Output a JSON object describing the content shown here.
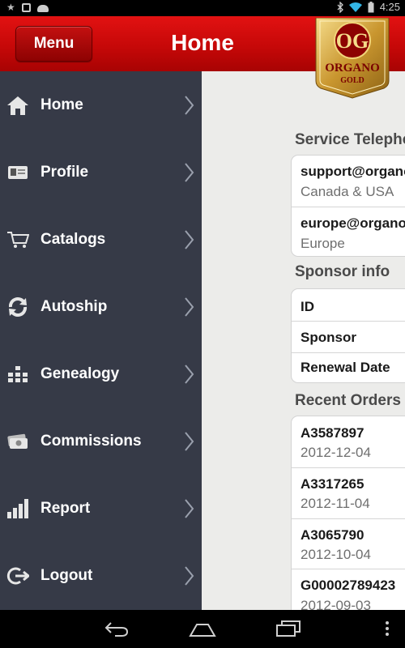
{
  "status_bar": {
    "time": "4:25"
  },
  "header": {
    "menu_label": "Menu",
    "title": "Home"
  },
  "logo": {
    "monogram": "OG",
    "brand": "ORGANO",
    "sub": "GOLD"
  },
  "sidebar": {
    "items": [
      {
        "label": "Home",
        "icon": "home-icon"
      },
      {
        "label": "Profile",
        "icon": "profile-card-icon"
      },
      {
        "label": "Catalogs",
        "icon": "cart-icon"
      },
      {
        "label": "Autoship",
        "icon": "refresh-icon"
      },
      {
        "label": "Genealogy",
        "icon": "tree-icon"
      },
      {
        "label": "Commissions",
        "icon": "money-icon"
      },
      {
        "label": "Report",
        "icon": "bar-chart-icon"
      },
      {
        "label": "Logout",
        "icon": "logout-icon"
      }
    ]
  },
  "service": {
    "title": "Service Telephone",
    "rows": [
      {
        "email": "support@organogold.com",
        "region": "Canada & USA"
      },
      {
        "email": "europe@organogold.com",
        "region": "Europe"
      }
    ]
  },
  "sponsor": {
    "title": "Sponsor info",
    "rows": [
      {
        "label": "ID"
      },
      {
        "label": "Sponsor"
      },
      {
        "label": "Renewal Date"
      }
    ]
  },
  "orders": {
    "title": "Recent Orders",
    "rows": [
      {
        "id": "A3587897",
        "date": "2012-12-04"
      },
      {
        "id": "A3317265",
        "date": "2012-11-04"
      },
      {
        "id": "A3065790",
        "date": "2012-10-04"
      },
      {
        "id": "G00002789423",
        "date": "2012-09-03"
      }
    ]
  },
  "colors": {
    "header_red": "#c60808",
    "sidebar_bg": "#363a47",
    "content_bg": "#ececea"
  }
}
